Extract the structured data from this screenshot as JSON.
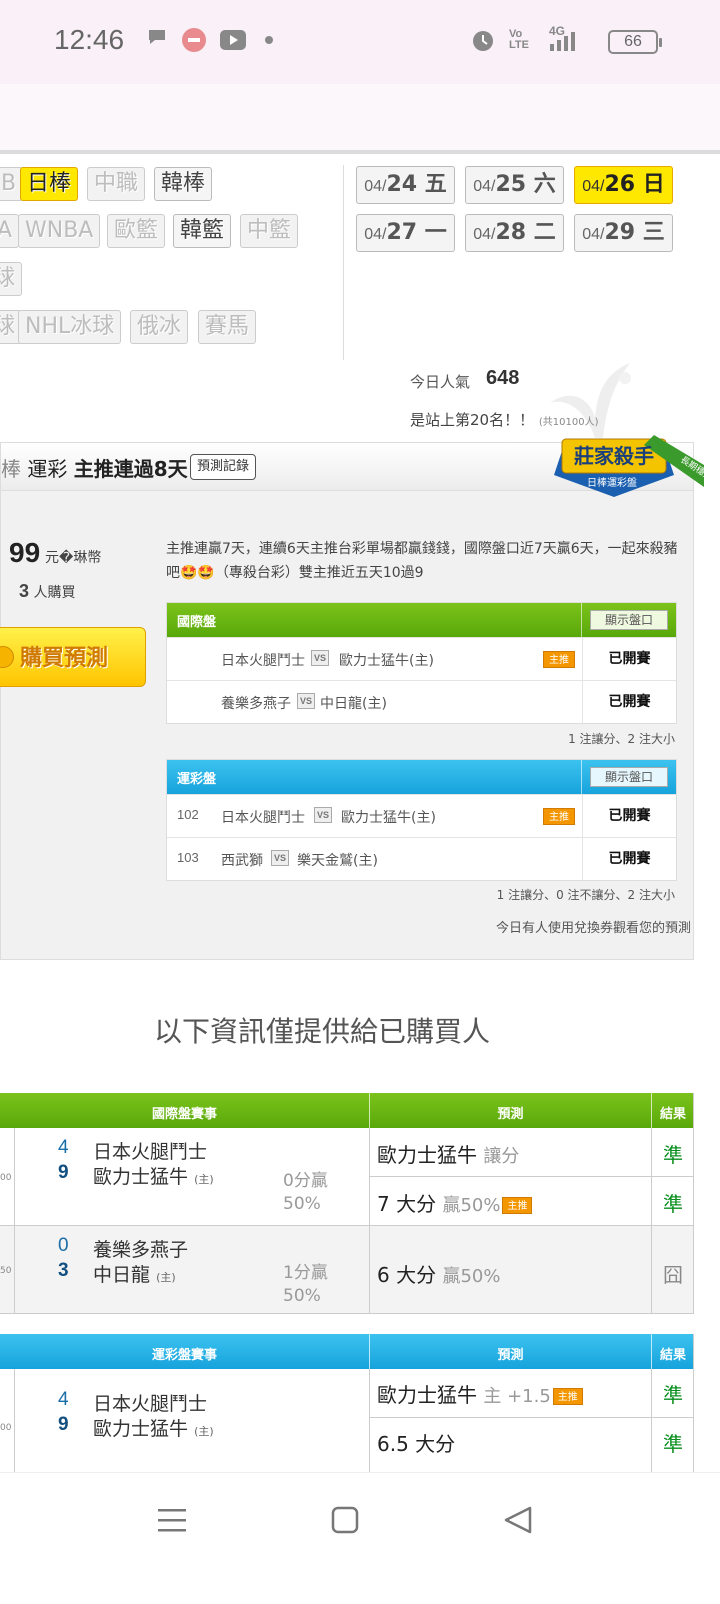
{
  "status_bar": {
    "time": "12:46",
    "battery": "66",
    "network": "4G",
    "volte": "Vo LTE",
    "icons": [
      "chat-bubble-icon",
      "app-notification-icon",
      "youtube-icon",
      "dot-icon",
      "alarm-icon",
      "volte-icon",
      "signal-icon",
      "battery-icon"
    ]
  },
  "league_tags": {
    "row1": [
      "日棒",
      "中職",
      "韓棒"
    ],
    "row2": [
      "WNBA",
      "歐籃",
      "韓籃",
      "中籃"
    ],
    "row4": [
      "NHL冰球",
      "俄冰",
      "賽馬"
    ]
  },
  "dates": [
    {
      "prefix": "04/",
      "day": "24 五"
    },
    {
      "prefix": "04/",
      "day": "25 六"
    },
    {
      "prefix": "04/",
      "day": "26 日"
    },
    {
      "prefix": "04/",
      "day": "27 一"
    },
    {
      "prefix": "04/",
      "day": "28 二"
    },
    {
      "prefix": "04/",
      "day": "29 三"
    }
  ],
  "popularity": {
    "label": "今日人氣",
    "value": "648",
    "rank_text": "是站上第20名！！",
    "rank_total": "(共10100人)"
  },
  "expert": {
    "name_prefix": "運彩",
    "name_highlight": "主推連過8天",
    "record_button": "預測記錄",
    "badge_title": "莊家殺手",
    "badge_subtitle": "日棒運彩盤",
    "badge_ribbon": "長期穩定",
    "price": "99",
    "price_unit": "元�琳幣",
    "buyers_count": "3",
    "buyers_label": "人購買",
    "buy_button": "購買預測",
    "description": "主推連贏7天，連續6天主推台彩單場都贏錢錢，國際盤口近7天贏6天，一起來殺豬吧🤩🤩（專殺台彩）雙主推近五天10過9"
  },
  "intl_box": {
    "title": "國際盤",
    "show_button": "顯示盤口",
    "rows": [
      {
        "num": "",
        "away": "日本火腿鬥士",
        "home": "歐力士猛牛(主)",
        "zhu": "主推",
        "status": "已開賽"
      },
      {
        "num": "",
        "away": "養樂多燕子",
        "home": "中日龍(主)",
        "zhu": "",
        "status": "已開賽"
      }
    ],
    "note": "1 注讓分、2 注大小"
  },
  "lottery_box": {
    "title": "運彩盤",
    "show_button": "顯示盤口",
    "rows": [
      {
        "num": "102",
        "away": "日本火腿鬥士",
        "home": "歐力士猛牛(主)",
        "zhu": "主推",
        "status": "已開賽"
      },
      {
        "num": "103",
        "away": "西武獅",
        "home": "樂天金鷲(主)",
        "zhu": "",
        "status": "已開賽"
      }
    ],
    "note": "1 注讓分、0 注不讓分、2 注大小"
  },
  "voucher_note": "今日有人使用兌換券觀看您的預測",
  "vs_label": "VS",
  "section_title": "以下資訊僅提供給已購買人",
  "intl_table": {
    "col_game": "國際盤賽事",
    "col_pred": "預測",
    "col_result": "結果",
    "groups": [
      {
        "cut_text": "00",
        "score_away": "4",
        "score_home": "9",
        "away": "日本火腿鬥士",
        "home": "歐力士猛牛",
        "home_tag": "(主)",
        "odds_line1": "0分贏",
        "odds_line2": "50%",
        "pred1": "歐力士猛牛",
        "pred1_extra": "讓分",
        "pred1_zhu": "",
        "res1": "準",
        "pred2": "7 大分",
        "pred2_extra": "贏50%",
        "pred2_zhu": "主推",
        "res2": "準"
      },
      {
        "cut_text": "50",
        "score_away": "0",
        "score_home": "3",
        "away": "養樂多燕子",
        "home": "中日龍",
        "home_tag": "(主)",
        "odds_line1": "1分贏",
        "odds_line2": "50%",
        "pred1": "6 大分",
        "pred1_extra": "贏50%",
        "pred1_zhu": "",
        "res1": "囧"
      }
    ]
  },
  "lottery_table": {
    "col_game": "運彩盤賽事",
    "col_pred": "預測",
    "col_result": "結果",
    "groups": [
      {
        "cut_text": "00",
        "score_away": "4",
        "score_home": "9",
        "away": "日本火腿鬥士",
        "home": "歐力士猛牛",
        "home_tag": "(主)",
        "pred1": "歐力士猛牛",
        "pred1_extra": "主 +1.5",
        "pred1_zhu": "主推",
        "res1": "準",
        "pred2": "6.5 大分",
        "res2": "準"
      }
    ]
  },
  "nav_bar": {
    "icons": [
      "menu-icon",
      "home-square-icon",
      "back-triangle-icon"
    ]
  },
  "colors": {
    "accent_yellow": "#ffe800",
    "green_header": "#58a80a",
    "blue_header": "#16a3dc",
    "result_green": "#0a8f1e",
    "zhu_orange": "#f39600"
  }
}
